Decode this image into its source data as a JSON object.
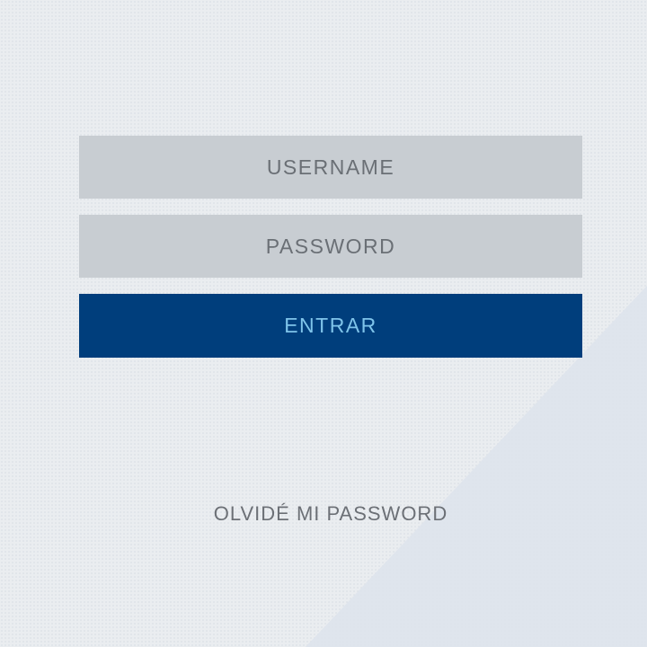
{
  "login": {
    "username_placeholder": "USERNAME",
    "password_placeholder": "PASSWORD",
    "submit_label": "ENTRAR",
    "forgot_password_label": "OLVIDÉ MI PASSWORD"
  },
  "colors": {
    "background": "#eaedf0",
    "field_background": "#c8cdd2",
    "button_background": "#003e7c",
    "button_text": "#7fc4ea",
    "muted_text": "#6c7076"
  }
}
